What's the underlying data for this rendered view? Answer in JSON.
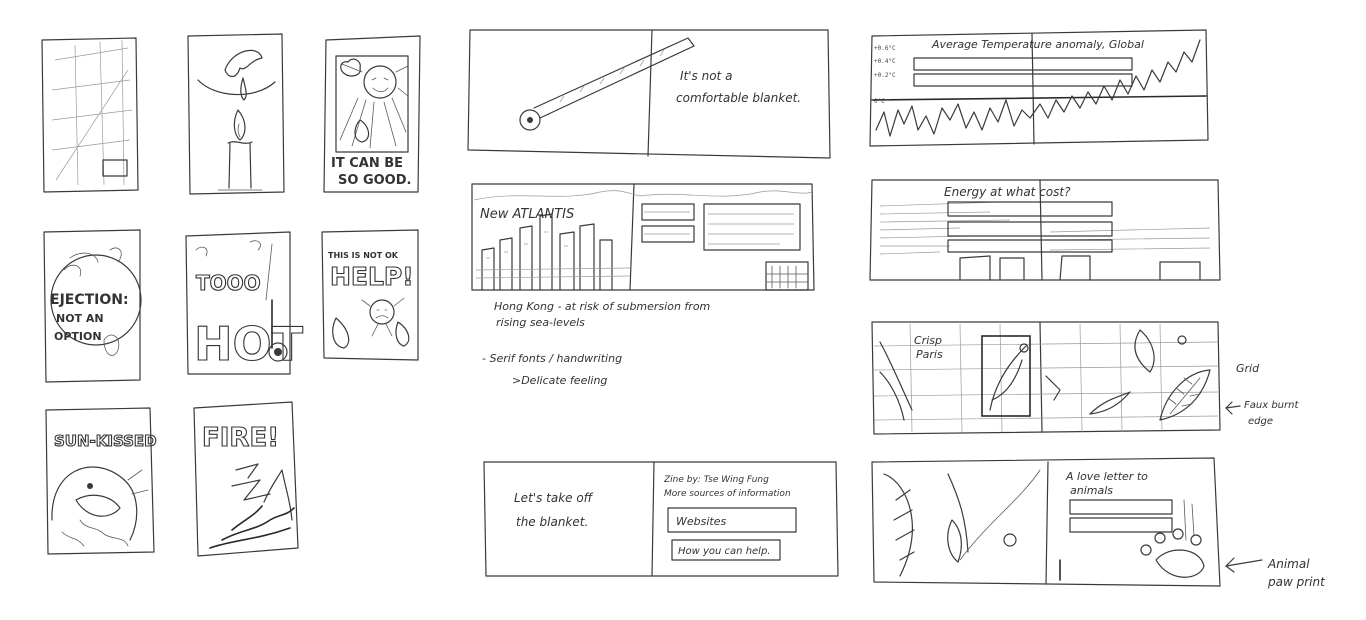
{
  "poster_sketches": {
    "candle_drip_panel": {},
    "sun_panel": {
      "caption_line1": "IT CAN BE",
      "caption_line2": "SO GOOD."
    },
    "ejection_panel": {
      "line1": "EJECTION:",
      "line2": "NOT AN",
      "line3": "OPTION"
    },
    "too_hot_panel": {
      "top": "TOOO",
      "bottom": "HOT"
    },
    "help_panel": {
      "small": "THIS IS NOT OK",
      "big": "HELP!"
    },
    "sunkissed_panel": {
      "title": "SUN-KISSED"
    },
    "fire_panel": {
      "title": "FIRE!"
    }
  },
  "web_sketches": {
    "thermometer_panel": {
      "line1": "It's not a",
      "line2": "comfortable blanket."
    },
    "atlantis_panel": {
      "title": "New ATLANTIS"
    },
    "atlantis_note": {
      "line1": "Hong Kong - at risk of submersion from",
      "line2": "rising sea-levels",
      "bullet1": "- Serif fonts / handwriting",
      "bullet2": ">Delicate feeling"
    },
    "blanket_panel": {
      "left_line1": "Let's take off",
      "left_line2": "the blanket.",
      "right_line1": "Zine by: Tse Wing Fung",
      "right_line2": "More sources of information",
      "button1": "Websites",
      "button2": "How you can help."
    }
  },
  "right_column": {
    "temperature_panel": {
      "title": "Average Temperature anomaly, Global",
      "ticks": [
        "+0.6°C",
        "+0.4°C",
        "+0.2°C",
        "0°C"
      ]
    },
    "energy_panel": {
      "title": "Energy at what cost?"
    },
    "crisp_panel": {
      "line1": "Crisp",
      "line2": "Paris"
    },
    "grid_note": "Grid",
    "faux_edge_note_line1": "Faux burnt",
    "faux_edge_note_line2": "edge",
    "animals_panel": {
      "line1": "A love letter to",
      "line2": "animals"
    },
    "animal_note_line1": "Animal",
    "animal_note_line2": "paw print"
  }
}
